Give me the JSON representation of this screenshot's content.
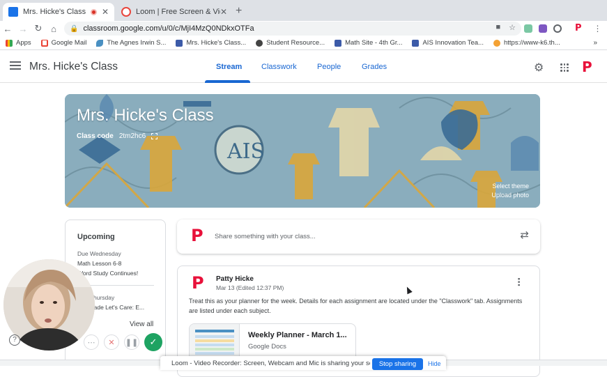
{
  "browser": {
    "tabs": [
      {
        "title": "Mrs. Hicke's Class",
        "active": true,
        "recording": true
      },
      {
        "title": "Loom | Free Screen & Video Re",
        "active": false
      }
    ],
    "url": "classroom.google.com/u/0/c/MjI4MzQ0NDkxOTFa",
    "bookmarks": [
      {
        "label": "Apps",
        "icon": "apps-grid-icon"
      },
      {
        "label": "Google Mail",
        "icon": "gmail-icon"
      },
      {
        "label": "The Agnes Irwin S...",
        "icon": "bird-icon"
      },
      {
        "label": "Mrs. Hicke's Class...",
        "icon": "classroom-icon"
      },
      {
        "label": "Student Resource...",
        "icon": "globe-icon"
      },
      {
        "label": "Math Site - 4th Gr...",
        "icon": "classroom-icon"
      },
      {
        "label": "AIS Innovation Tea...",
        "icon": "classroom-icon"
      },
      {
        "label": "https://www-k6.th...",
        "icon": "orange-circle-icon"
      }
    ]
  },
  "appbar": {
    "class_name": "Mrs. Hicke's Class",
    "tabs": [
      "Stream",
      "Classwork",
      "People",
      "Grades"
    ],
    "active_tab": "Stream",
    "accent": "#1967d2",
    "logo_letter": "P"
  },
  "banner": {
    "title": "Mrs. Hicke's Class",
    "class_code_label": "Class code",
    "class_code": "2tm2hc6",
    "select_theme": "Select theme",
    "upload_photo": "Upload photo"
  },
  "upcoming": {
    "title": "Upcoming",
    "groups": [
      {
        "due": "Due Wednesday",
        "items": [
          "Math Lesson 6-8",
          "Word Study Continues!"
        ]
      },
      {
        "due": "Due Thursday",
        "items": [
          "4th Grade Let's Care: E..."
        ]
      }
    ],
    "view_all": "View all"
  },
  "share_box": {
    "placeholder": "Share something with your class..."
  },
  "post": {
    "author": "Patty Hicke",
    "date": "Mar 13 (Edited 12:37 PM)",
    "body": "Treat this as your planner for the week. Details for each assignment are located under the \"Classwork\" tab. Assignments are listed under each subject.",
    "attachment": {
      "title": "Weekly Planner - March 1...",
      "type": "Google Docs"
    }
  },
  "loom": {
    "sharing_text": "Loom - Video Recorder: Screen, Webcam and Mic is sharing your screen.",
    "stop_sharing": "Stop sharing",
    "hide": "Hide"
  }
}
